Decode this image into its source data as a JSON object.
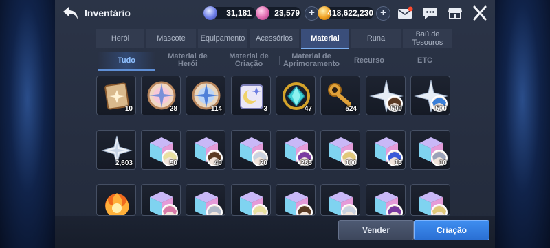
{
  "header": {
    "title": "Inventário",
    "currencies": [
      {
        "name": "crystal-icon",
        "value": "31,181",
        "color": "#7b8ff0"
      },
      {
        "name": "gem-icon",
        "value": "23,579",
        "color": "#e06ab0"
      },
      {
        "name": "gold-icon",
        "value": "418,622,230",
        "color": "#f0a020"
      }
    ]
  },
  "tabs": [
    {
      "label": "Herói"
    },
    {
      "label": "Mascote"
    },
    {
      "label": "Equipamento"
    },
    {
      "label": "Acessórios"
    },
    {
      "label": "Material"
    },
    {
      "label": "Runa"
    },
    {
      "label": "Baú de Tesouros"
    }
  ],
  "subtabs": [
    {
      "label": "Tudo"
    },
    {
      "label": "Material de Herói"
    },
    {
      "label": "Material de Criação"
    },
    {
      "label": "Material de Aprimoramento"
    },
    {
      "label": "Recurso"
    },
    {
      "label": "ETC"
    }
  ],
  "items": [
    {
      "icon": "scroll-icon",
      "qty": "10"
    },
    {
      "icon": "compass-pink-icon",
      "qty": "28"
    },
    {
      "icon": "compass-blue-icon",
      "qty": "114"
    },
    {
      "icon": "moon-scroll-icon",
      "qty": "3"
    },
    {
      "icon": "golden-gem-icon",
      "qty": "47"
    },
    {
      "icon": "golden-key-icon",
      "qty": "524"
    },
    {
      "icon": "star-brown-hair-icon",
      "qty": "500"
    },
    {
      "icon": "star-blue-hair-icon",
      "qty": "500"
    },
    {
      "icon": "white-star-icon",
      "qty": "2,603"
    },
    {
      "icon": "cube-hero-icon",
      "qty": "50"
    },
    {
      "icon": "cube-hero-icon",
      "qty": "40"
    },
    {
      "icon": "cube-hero-icon",
      "qty": "20"
    },
    {
      "icon": "cube-hero-icon",
      "qty": "285"
    },
    {
      "icon": "cube-hero-icon",
      "qty": "100"
    },
    {
      "icon": "cube-hero-icon",
      "qty": "15"
    },
    {
      "icon": "cube-hero-icon",
      "qty": "10"
    },
    {
      "icon": "fire-orb-icon",
      "qty": ""
    },
    {
      "icon": "cube-hero-icon",
      "qty": ""
    },
    {
      "icon": "cube-hero-icon",
      "qty": ""
    },
    {
      "icon": "cube-hero-icon",
      "qty": ""
    },
    {
      "icon": "cube-hero-icon",
      "qty": ""
    },
    {
      "icon": "cube-hero-icon",
      "qty": ""
    },
    {
      "icon": "cube-hero-icon",
      "qty": ""
    },
    {
      "icon": "cube-hero-icon",
      "qty": ""
    }
  ],
  "buttons": {
    "sell": "Vender",
    "create": "Criação"
  },
  "colors": {
    "accent": "#3f8ef0",
    "panel": "#2b3447"
  }
}
